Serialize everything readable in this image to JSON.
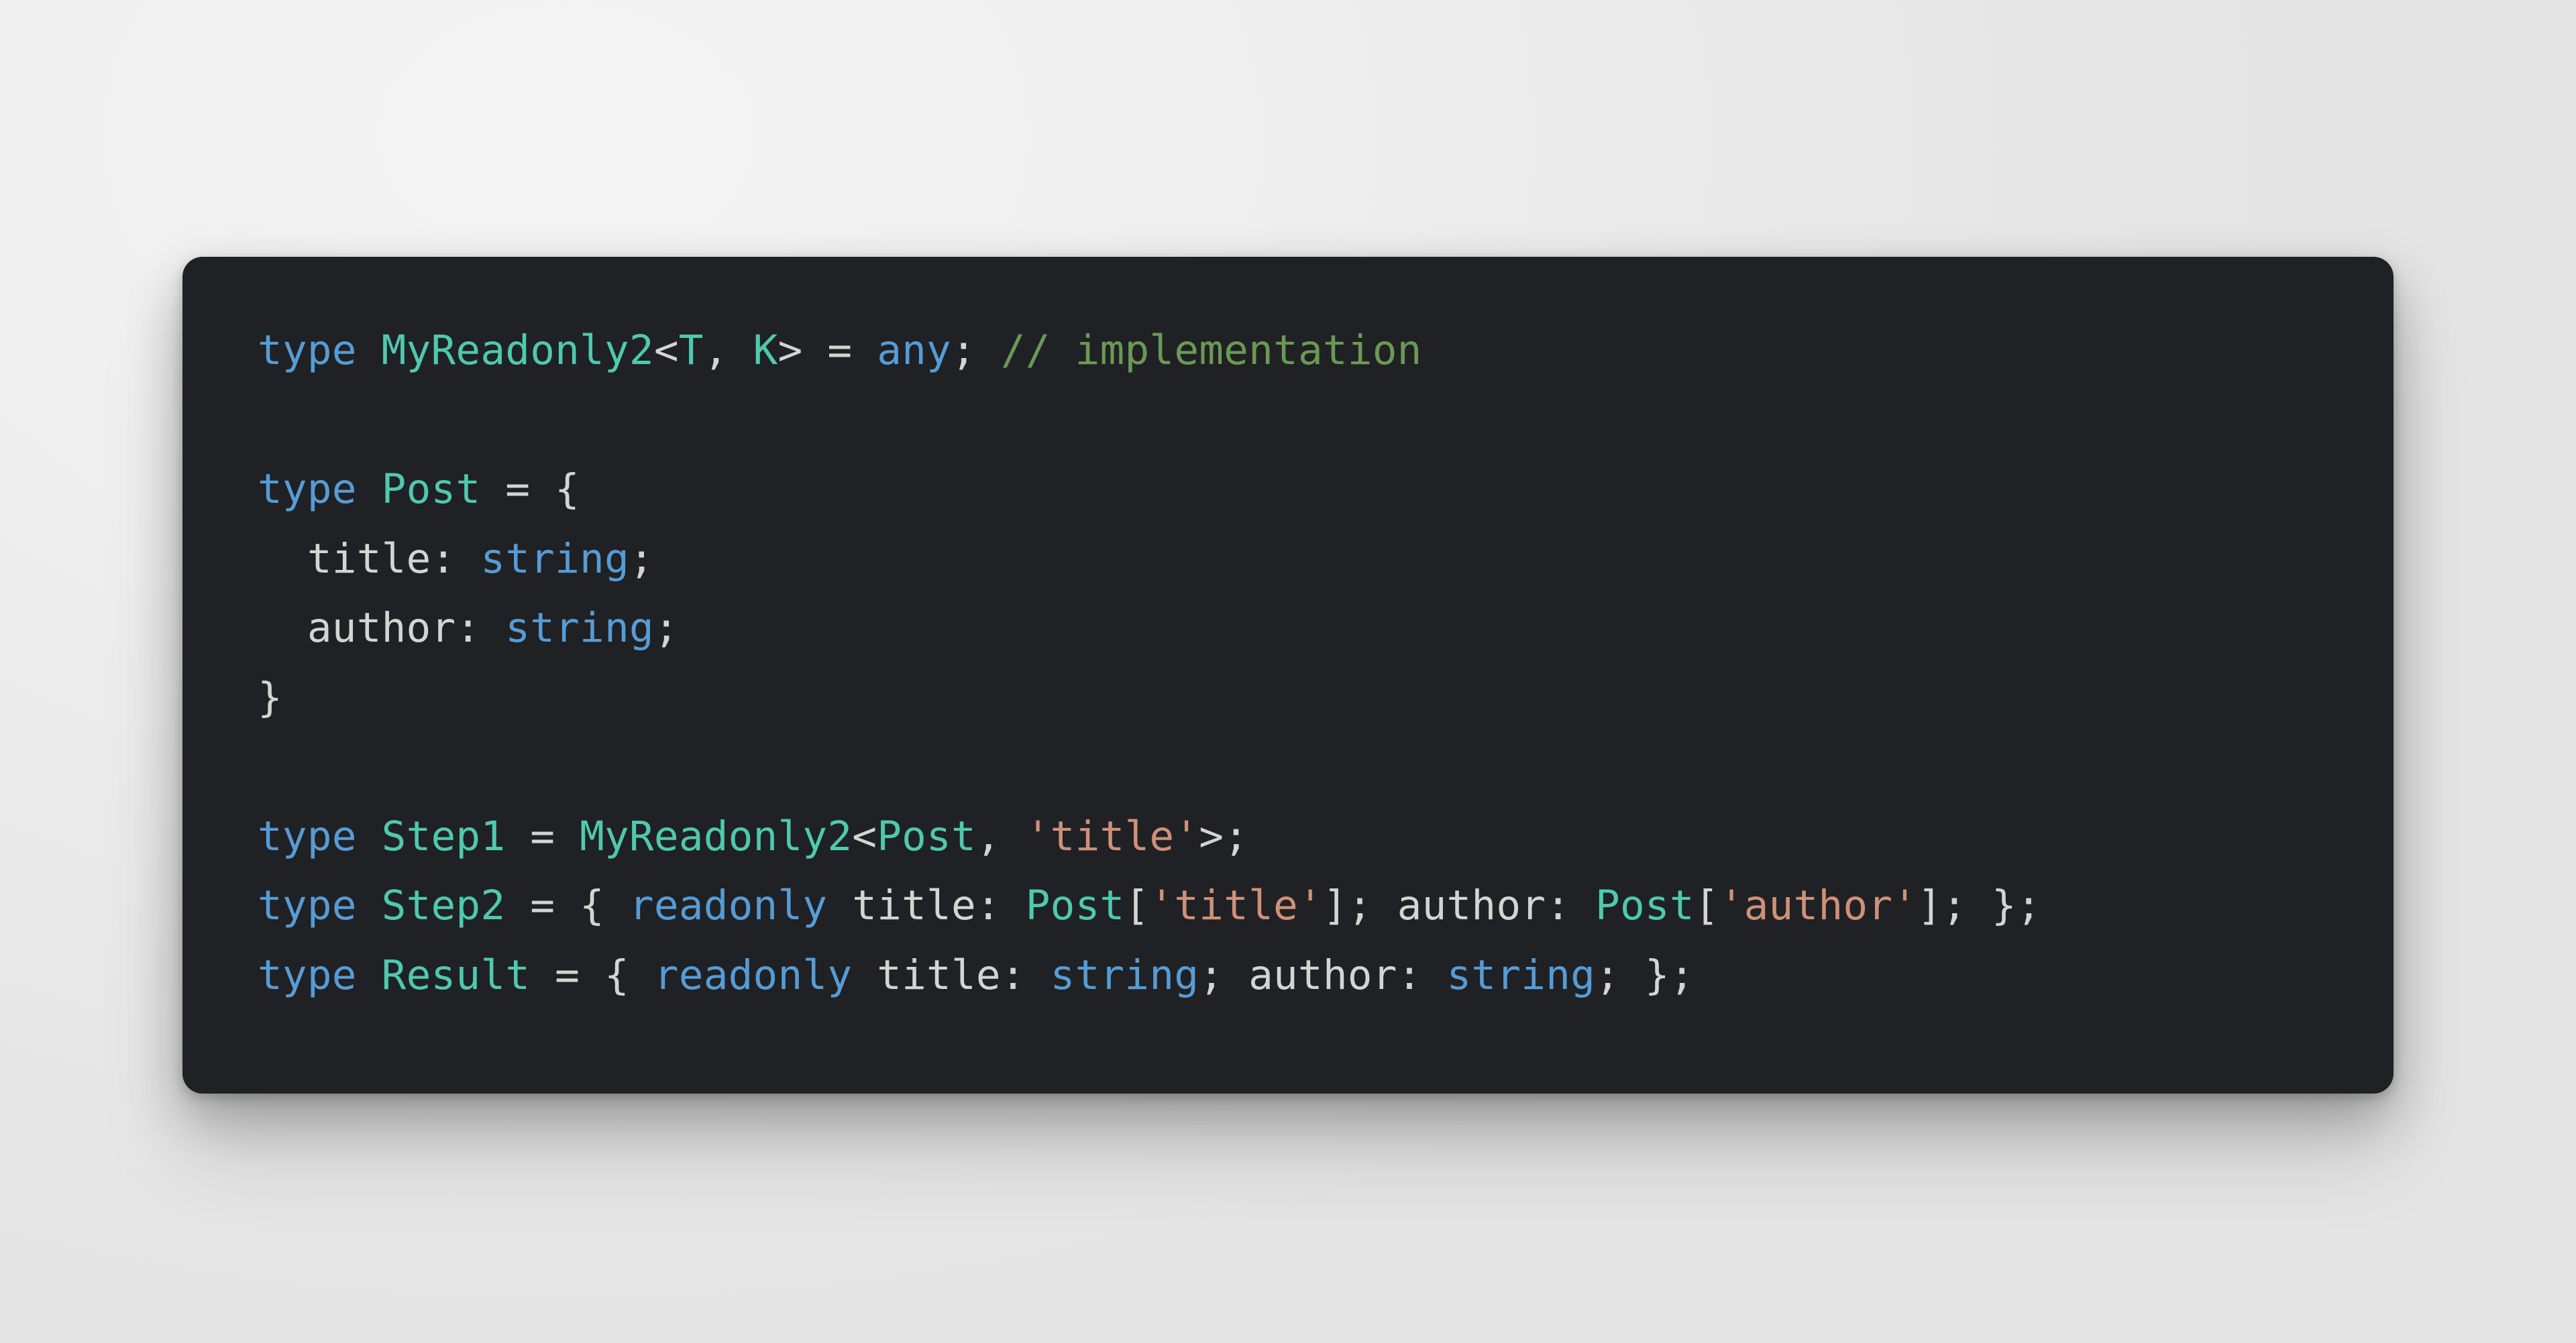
{
  "card": {
    "background_color": "#202124",
    "corner_radius_px": 30,
    "language": "typescript"
  },
  "canvas": {
    "background_color": "#efefef"
  },
  "theme": {
    "keyword_color": "#569cd6",
    "type_color": "#4ec9b0",
    "plain_color": "#d4d4d4",
    "string_color": "#ce9178",
    "comment_color": "#6a9955"
  },
  "code": {
    "full_text": "type MyReadonly2<T, K> = any; // implementation\n\ntype Post = {\n  title: string;\n  author: string;\n}\n\ntype Step1 = MyReadonly2<Post, 'title'>;\ntype Step2 = { readonly title: Post['title']; author: Post['author']; };\ntype Result = { readonly title: string; author: string; };",
    "lines": [
      {
        "index": 1,
        "text": "type MyReadonly2<T, K> = any; // implementation",
        "tokens": [
          {
            "t": "type",
            "c": "keyword"
          },
          {
            "t": " ",
            "c": "plain"
          },
          {
            "t": "MyReadonly2",
            "c": "type"
          },
          {
            "t": "<",
            "c": "plain"
          },
          {
            "t": "T",
            "c": "type"
          },
          {
            "t": ", ",
            "c": "plain"
          },
          {
            "t": "K",
            "c": "type"
          },
          {
            "t": "> = ",
            "c": "plain"
          },
          {
            "t": "any",
            "c": "keyword"
          },
          {
            "t": "; ",
            "c": "plain"
          },
          {
            "t": "// implementation",
            "c": "comment"
          }
        ]
      },
      {
        "index": 2,
        "text": "",
        "tokens": []
      },
      {
        "index": 3,
        "text": "type Post = {",
        "tokens": [
          {
            "t": "type",
            "c": "keyword"
          },
          {
            "t": " ",
            "c": "plain"
          },
          {
            "t": "Post",
            "c": "type"
          },
          {
            "t": " = {",
            "c": "plain"
          }
        ]
      },
      {
        "index": 4,
        "text": "  title: string;",
        "tokens": [
          {
            "t": "  title: ",
            "c": "prop"
          },
          {
            "t": "string",
            "c": "keyword"
          },
          {
            "t": ";",
            "c": "plain"
          }
        ]
      },
      {
        "index": 5,
        "text": "  author: string;",
        "tokens": [
          {
            "t": "  author: ",
            "c": "prop"
          },
          {
            "t": "string",
            "c": "keyword"
          },
          {
            "t": ";",
            "c": "plain"
          }
        ]
      },
      {
        "index": 6,
        "text": "}",
        "tokens": [
          {
            "t": "}",
            "c": "plain"
          }
        ]
      },
      {
        "index": 7,
        "text": "",
        "tokens": []
      },
      {
        "index": 8,
        "text": "type Step1 = MyReadonly2<Post, 'title'>;",
        "tokens": [
          {
            "t": "type",
            "c": "keyword"
          },
          {
            "t": " ",
            "c": "plain"
          },
          {
            "t": "Step1",
            "c": "type"
          },
          {
            "t": " = ",
            "c": "plain"
          },
          {
            "t": "MyReadonly2",
            "c": "type"
          },
          {
            "t": "<",
            "c": "plain"
          },
          {
            "t": "Post",
            "c": "type"
          },
          {
            "t": ", ",
            "c": "plain"
          },
          {
            "t": "'title'",
            "c": "string"
          },
          {
            "t": ">;",
            "c": "plain"
          }
        ]
      },
      {
        "index": 9,
        "text": "type Step2 = { readonly title: Post['title']; author: Post['author']; };",
        "tokens": [
          {
            "t": "type",
            "c": "keyword"
          },
          {
            "t": " ",
            "c": "plain"
          },
          {
            "t": "Step2",
            "c": "type"
          },
          {
            "t": " = { ",
            "c": "plain"
          },
          {
            "t": "readonly",
            "c": "keyword"
          },
          {
            "t": " title: ",
            "c": "prop"
          },
          {
            "t": "Post",
            "c": "type"
          },
          {
            "t": "[",
            "c": "plain"
          },
          {
            "t": "'title'",
            "c": "string"
          },
          {
            "t": "]; ",
            "c": "plain"
          },
          {
            "t": "author: ",
            "c": "prop"
          },
          {
            "t": "Post",
            "c": "type"
          },
          {
            "t": "[",
            "c": "plain"
          },
          {
            "t": "'author'",
            "c": "string"
          },
          {
            "t": "]; };",
            "c": "plain"
          }
        ]
      },
      {
        "index": 10,
        "text": "type Result = { readonly title: string; author: string; };",
        "tokens": [
          {
            "t": "type",
            "c": "keyword"
          },
          {
            "t": " ",
            "c": "plain"
          },
          {
            "t": "Result",
            "c": "type"
          },
          {
            "t": " = { ",
            "c": "plain"
          },
          {
            "t": "readonly",
            "c": "keyword"
          },
          {
            "t": " title: ",
            "c": "prop"
          },
          {
            "t": "string",
            "c": "keyword"
          },
          {
            "t": "; ",
            "c": "plain"
          },
          {
            "t": "author: ",
            "c": "prop"
          },
          {
            "t": "string",
            "c": "keyword"
          },
          {
            "t": "; };",
            "c": "plain"
          }
        ]
      }
    ]
  }
}
